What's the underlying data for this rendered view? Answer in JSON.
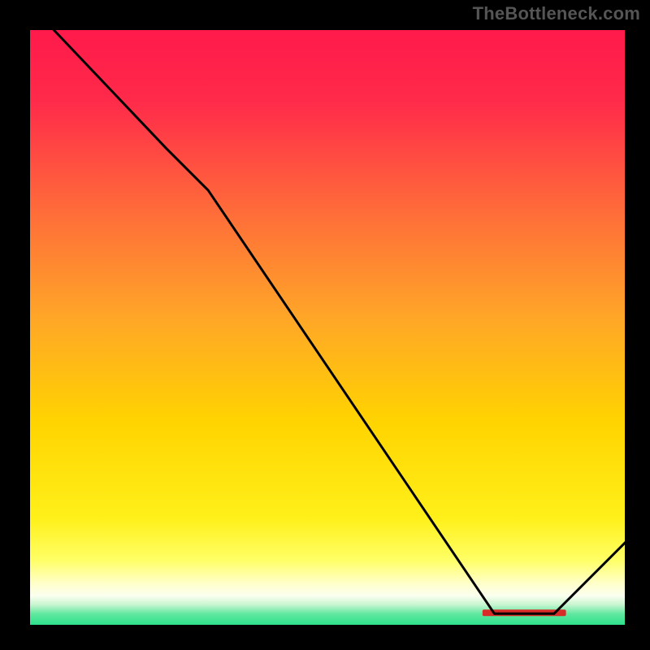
{
  "watermark": "TheBottleneck.com",
  "chart_data": {
    "type": "line",
    "title": "",
    "xlabel": "",
    "ylabel": "",
    "xlim": [
      0,
      100
    ],
    "ylim": [
      0,
      100
    ],
    "grid": false,
    "legend": false,
    "background_gradient": {
      "top_color": "#ff1a4b",
      "mid_color": "#ffd400",
      "pale_band_color": "#ffffcc",
      "bottom_band_color": "#29e08a"
    },
    "series": [
      {
        "name": "curve",
        "color": "#000000",
        "x": [
          4,
          23,
          30,
          78,
          88,
          100
        ],
        "y": [
          100,
          80,
          73,
          2,
          2,
          14
        ]
      }
    ],
    "annotations": [
      {
        "text": "",
        "x_start": 76,
        "x_end": 90,
        "y": 2,
        "style": "red-dash-band"
      }
    ]
  }
}
